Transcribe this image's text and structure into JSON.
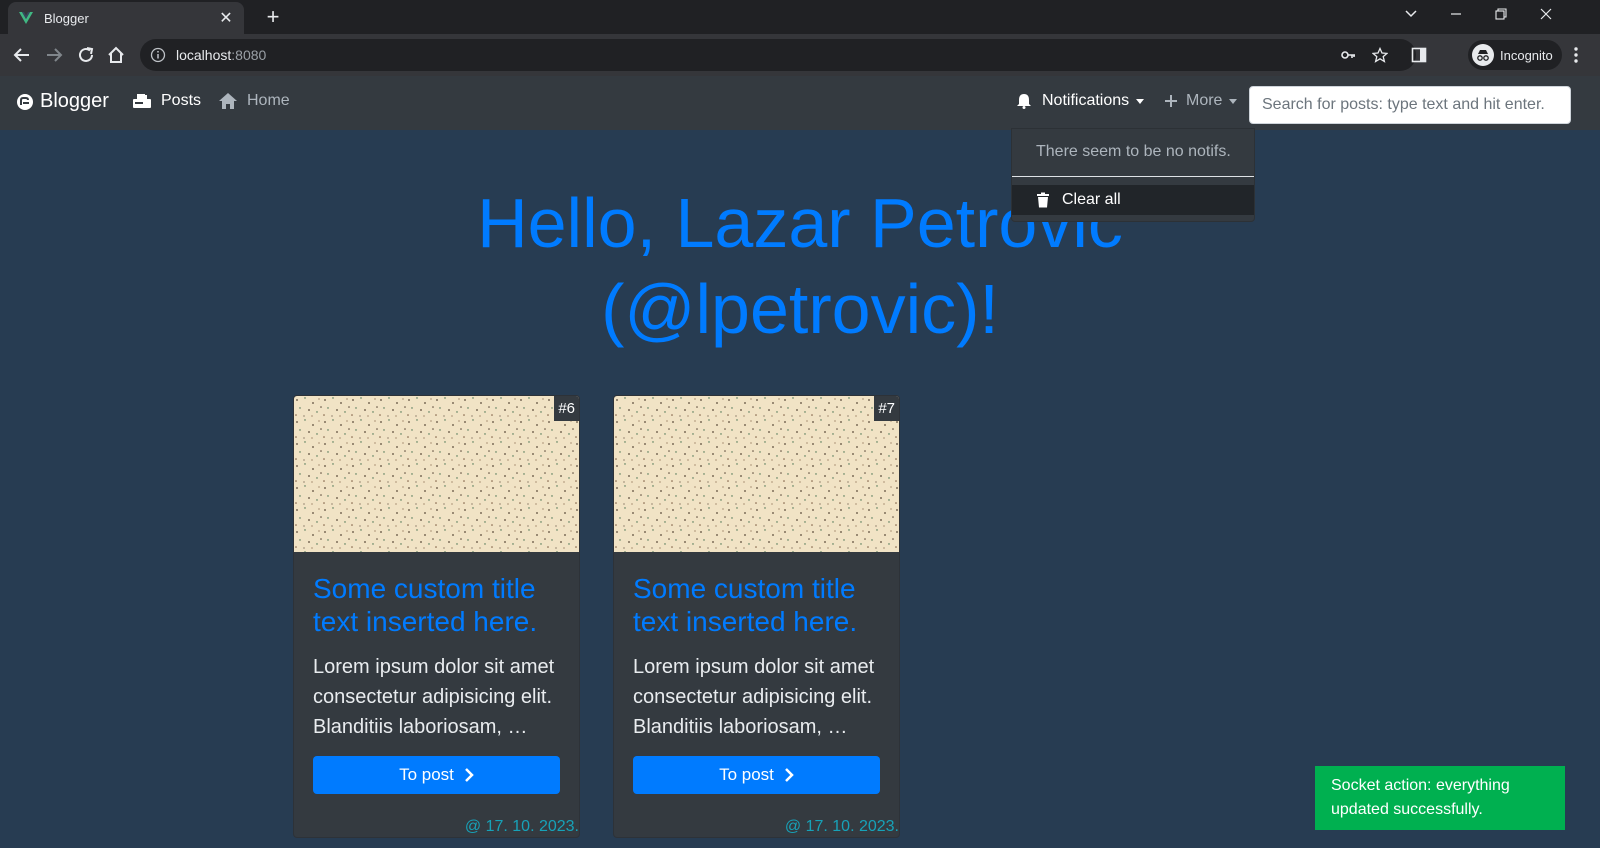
{
  "browser": {
    "tab_title": "Blogger",
    "url_host": "localhost",
    "url_port": ":8080",
    "profile_label": "Incognito",
    "colors": {
      "frame": "#202124",
      "toolbar": "#35363a",
      "vue_green": "#41b883"
    }
  },
  "navbar": {
    "brand": "Blogger",
    "links": [
      {
        "label": "Posts",
        "icon": "mailbox-icon"
      },
      {
        "label": "Home",
        "icon": "home-icon"
      }
    ],
    "notifications_label": "Notifications",
    "more_label": "More",
    "search_placeholder": "Search for posts: type text and hit enter."
  },
  "notifications_dropdown": {
    "empty_text": "There seem to be no notifs.",
    "clear_label": "Clear all"
  },
  "hero": {
    "line1": "Hello, Lazar Petrovic",
    "line2": "(@lpetrovic)!"
  },
  "posts": [
    {
      "id_label": "#6",
      "title": "Some custom title text inserted here.",
      "excerpt": "Lorem ipsum dolor sit amet consectetur adipisicing elit. Blanditiis laboriosam, …",
      "button_label": "To post",
      "date": "@ 17. 10. 2023."
    },
    {
      "id_label": "#7",
      "title": "Some custom title text inserted here.",
      "excerpt": "Lorem ipsum dolor sit amet consectetur adipisicing elit. Blanditiis laboriosam, …",
      "button_label": "To post",
      "date": "@ 17. 10. 2023."
    }
  ],
  "toast": {
    "message": "Socket action: everything updated successfully.",
    "color": "#00b050"
  },
  "theme": {
    "background": "#273c52",
    "accent": "#007bff",
    "card_bg": "#343a40",
    "date_color": "#17a2b8"
  }
}
